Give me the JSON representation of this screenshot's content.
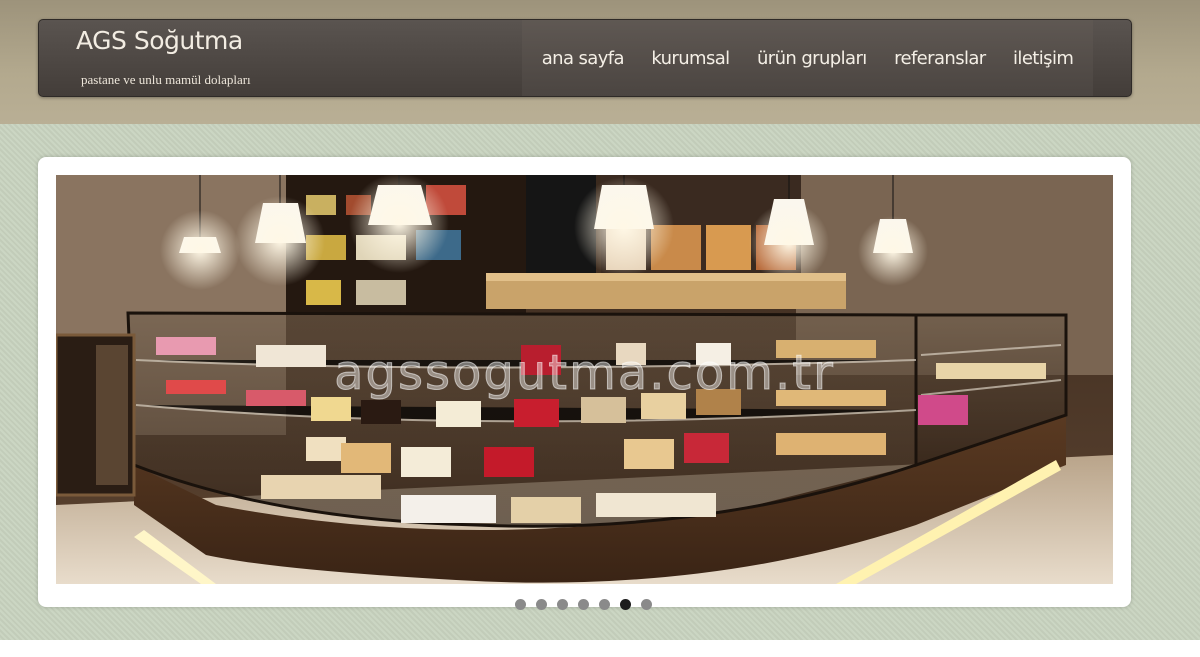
{
  "header": {
    "site_title": "AGS Soğutma",
    "tagline": "pastane ve unlu mamül dolapları"
  },
  "nav": {
    "items": [
      {
        "label": "ana sayfa",
        "name": "nav-ana-sayfa"
      },
      {
        "label": "kurumsal",
        "name": "nav-kurumsal"
      },
      {
        "label": "ürün grupları",
        "name": "nav-urun-gruplari"
      },
      {
        "label": "referanslar",
        "name": "nav-referanslar"
      },
      {
        "label": "iletişim",
        "name": "nav-iletisim"
      }
    ]
  },
  "slider": {
    "watermark": "agssogutma.com.tr",
    "image_description": "Pastane vitrin dolabı fotoğrafı",
    "dot_count": 7,
    "active_index": 5
  },
  "colors": {
    "header_bg": "#4a4440",
    "nav_text": "#f4efe6",
    "top_band": "#b3a98e",
    "main_band": "#c8d3bf",
    "dot": "#8a8a8a",
    "dot_active": "#1c1c1c"
  }
}
